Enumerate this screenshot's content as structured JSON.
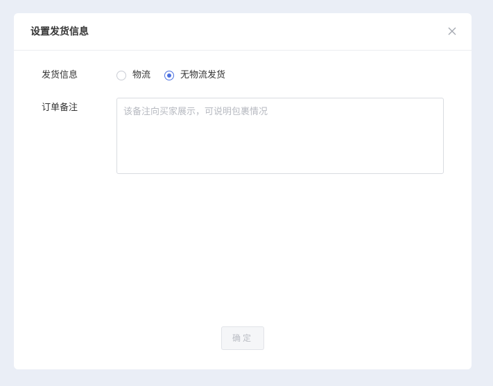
{
  "dialog": {
    "title": "设置发货信息",
    "close_icon": "close-icon"
  },
  "form": {
    "shipping_label": "发货信息",
    "shipping_options": [
      {
        "label": "物流",
        "checked": false
      },
      {
        "label": "无物流发货",
        "checked": true
      }
    ],
    "remark_label": "订单备注",
    "remark_value": "",
    "remark_placeholder": "该备注向买家展示，可说明包裹情况"
  },
  "footer": {
    "confirm_label": "确定",
    "confirm_enabled": false
  },
  "colors": {
    "accent": "#4a6fe0",
    "page_background": "#eaeef6",
    "dialog_background": "#ffffff"
  }
}
